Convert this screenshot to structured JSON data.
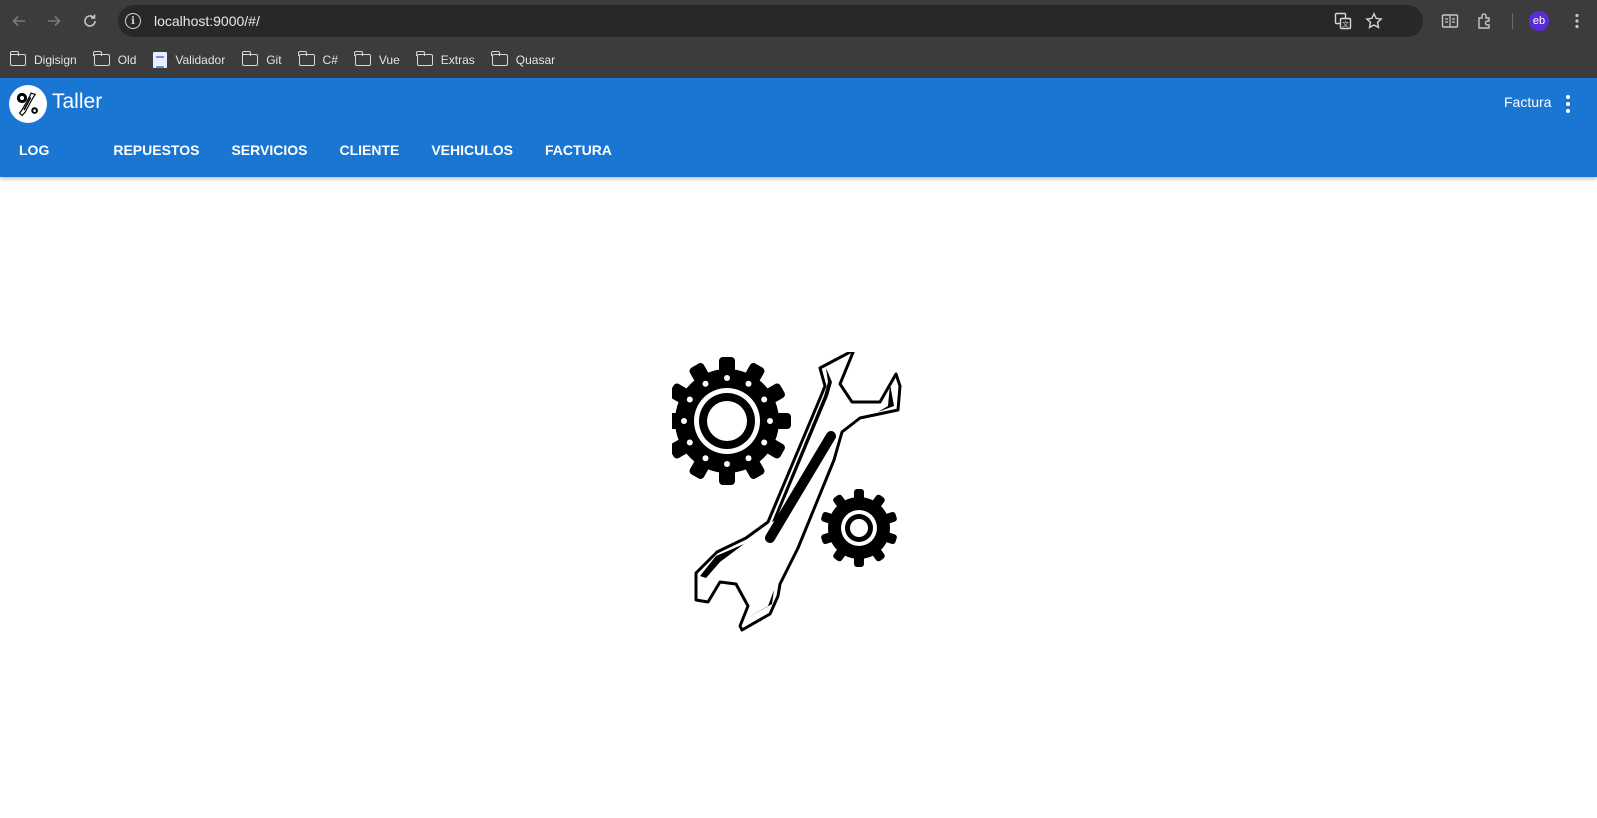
{
  "browser": {
    "url": "localhost:9000/#/",
    "profile_initials": "eb",
    "bookmarks": [
      {
        "label": "Digisign",
        "icon": "folder-icon"
      },
      {
        "label": "Old",
        "icon": "folder-icon"
      },
      {
        "label": "Validador",
        "icon": "document-icon"
      },
      {
        "label": "Git",
        "icon": "folder-icon"
      },
      {
        "label": "C#",
        "icon": "folder-icon"
      },
      {
        "label": "Vue",
        "icon": "folder-icon"
      },
      {
        "label": "Extras",
        "icon": "folder-icon"
      },
      {
        "label": "Quasar",
        "icon": "folder-icon"
      }
    ]
  },
  "header": {
    "title": "Taller",
    "right_label": "Factura"
  },
  "tabs": [
    "LOG",
    "REPUESTOS",
    "SERVICIOS",
    "CLIENTE",
    "VEHICULOS",
    "FACTURA"
  ],
  "colors": {
    "primary": "#1976d2",
    "chrome": "#3c3c3c",
    "omnibox": "#282828",
    "avatar": "#5b2bd6"
  }
}
